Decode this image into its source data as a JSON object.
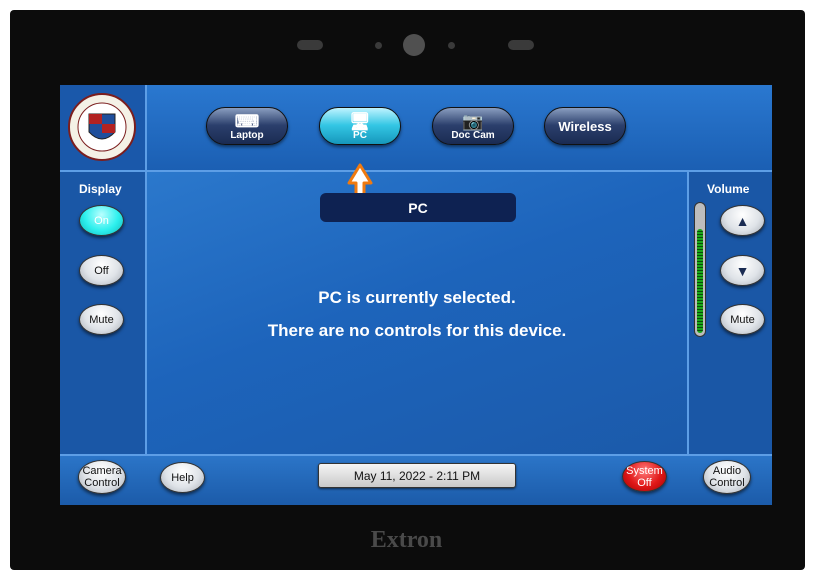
{
  "brand": "Extron",
  "sources": [
    {
      "label": "Laptop",
      "icon": "laptop-icon",
      "glyph": "⌨",
      "active": false
    },
    {
      "label": "PC",
      "icon": "pc-icon",
      "glyph": "🖥",
      "active": true
    },
    {
      "label": "Doc Cam",
      "icon": "doc-cam-icon",
      "glyph": "📷",
      "active": false
    },
    {
      "label": "Wireless",
      "icon": "",
      "glyph": "",
      "active": false
    }
  ],
  "display": {
    "title": "Display",
    "on": "On",
    "off": "Off",
    "mute": "Mute"
  },
  "volume": {
    "title": "Volume",
    "mute": "Mute",
    "level": 0.85,
    "up_glyph": "▲",
    "down_glyph": "▼"
  },
  "main": {
    "current_source": "PC",
    "status_line1": "PC is currently selected.",
    "status_line2": "There are no controls for this device."
  },
  "footer": {
    "camera_control": "Camera Control",
    "help": "Help",
    "datetime": "May 11, 2022  -  2:11 PM",
    "system_off": "System Off",
    "audio_control": "Audio Control"
  },
  "colors": {
    "screen_bg": "#1d5fb4",
    "active_on": "#2ef0ee",
    "system_off": "#e01818",
    "arrow": "#f07a10"
  }
}
